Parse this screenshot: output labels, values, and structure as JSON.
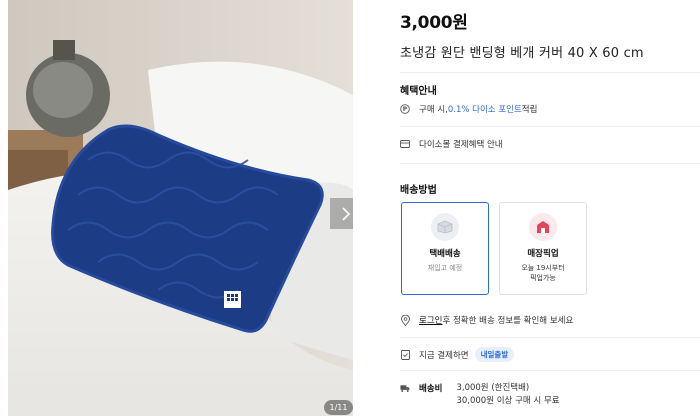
{
  "gallery": {
    "counter": "1/11"
  },
  "product": {
    "price": "3,000원",
    "title": "초냉감 원단 밴딩형 베개 커버 40 X 60 cm"
  },
  "benefits": {
    "title": "혜택안내",
    "points_prefix": "구매 시, ",
    "points_highlight": "0.1% 다이소 포인트",
    "points_suffix": " 적립",
    "payment_info": "다이소몰 결제혜택 안내"
  },
  "shipping": {
    "title": "배송방법",
    "options": [
      {
        "name": "택배배송",
        "sub": "재입고 예정"
      },
      {
        "name": "매장픽업",
        "sub1": "오늘 19시부터",
        "sub2": "픽업가능"
      }
    ],
    "login_link": "로그인",
    "login_text": " 후 정확한 배송 정보를 확인해 보세요",
    "pay_now": "지금 결제하면",
    "arrival_tag": "내일출발",
    "fee_label": "배송비",
    "fee_line1": "3,000원 (한진택배)",
    "fee_line2": "30,000원 이상 구매 시 무료"
  },
  "colors": {
    "accent": "#2f6bd8",
    "pillow": "#1d3c86"
  }
}
